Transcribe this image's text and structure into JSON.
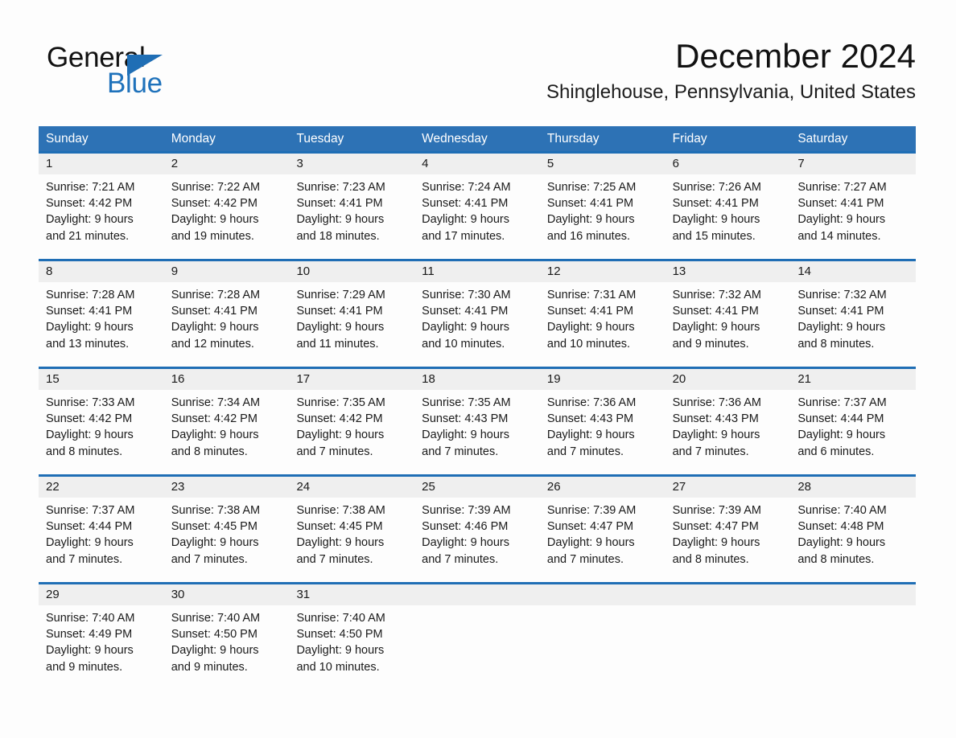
{
  "brand": {
    "name_part1": "General",
    "name_part2": "Blue",
    "triangle_color": "#1f6eb5",
    "blue_color": "#1f72bb"
  },
  "header": {
    "month_title": "December 2024",
    "location": "Shinglehouse, Pennsylvania, United States"
  },
  "theme": {
    "header_blue": "#2d72b5",
    "rule_blue": "#1f6eb5",
    "date_band_gray": "#efefef",
    "page_background": "#fdfdfd",
    "text_color": "#1a1a1a"
  },
  "weekdays": [
    "Sunday",
    "Monday",
    "Tuesday",
    "Wednesday",
    "Thursday",
    "Friday",
    "Saturday"
  ],
  "weeks": [
    {
      "days": [
        {
          "date": "1",
          "sunrise": "Sunrise: 7:21 AM",
          "sunset": "Sunset: 4:42 PM",
          "daylight_line1": "Daylight: 9 hours",
          "daylight_line2": "and 21 minutes."
        },
        {
          "date": "2",
          "sunrise": "Sunrise: 7:22 AM",
          "sunset": "Sunset: 4:42 PM",
          "daylight_line1": "Daylight: 9 hours",
          "daylight_line2": "and 19 minutes."
        },
        {
          "date": "3",
          "sunrise": "Sunrise: 7:23 AM",
          "sunset": "Sunset: 4:41 PM",
          "daylight_line1": "Daylight: 9 hours",
          "daylight_line2": "and 18 minutes."
        },
        {
          "date": "4",
          "sunrise": "Sunrise: 7:24 AM",
          "sunset": "Sunset: 4:41 PM",
          "daylight_line1": "Daylight: 9 hours",
          "daylight_line2": "and 17 minutes."
        },
        {
          "date": "5",
          "sunrise": "Sunrise: 7:25 AM",
          "sunset": "Sunset: 4:41 PM",
          "daylight_line1": "Daylight: 9 hours",
          "daylight_line2": "and 16 minutes."
        },
        {
          "date": "6",
          "sunrise": "Sunrise: 7:26 AM",
          "sunset": "Sunset: 4:41 PM",
          "daylight_line1": "Daylight: 9 hours",
          "daylight_line2": "and 15 minutes."
        },
        {
          "date": "7",
          "sunrise": "Sunrise: 7:27 AM",
          "sunset": "Sunset: 4:41 PM",
          "daylight_line1": "Daylight: 9 hours",
          "daylight_line2": "and 14 minutes."
        }
      ]
    },
    {
      "days": [
        {
          "date": "8",
          "sunrise": "Sunrise: 7:28 AM",
          "sunset": "Sunset: 4:41 PM",
          "daylight_line1": "Daylight: 9 hours",
          "daylight_line2": "and 13 minutes."
        },
        {
          "date": "9",
          "sunrise": "Sunrise: 7:28 AM",
          "sunset": "Sunset: 4:41 PM",
          "daylight_line1": "Daylight: 9 hours",
          "daylight_line2": "and 12 minutes."
        },
        {
          "date": "10",
          "sunrise": "Sunrise: 7:29 AM",
          "sunset": "Sunset: 4:41 PM",
          "daylight_line1": "Daylight: 9 hours",
          "daylight_line2": "and 11 minutes."
        },
        {
          "date": "11",
          "sunrise": "Sunrise: 7:30 AM",
          "sunset": "Sunset: 4:41 PM",
          "daylight_line1": "Daylight: 9 hours",
          "daylight_line2": "and 10 minutes."
        },
        {
          "date": "12",
          "sunrise": "Sunrise: 7:31 AM",
          "sunset": "Sunset: 4:41 PM",
          "daylight_line1": "Daylight: 9 hours",
          "daylight_line2": "and 10 minutes."
        },
        {
          "date": "13",
          "sunrise": "Sunrise: 7:32 AM",
          "sunset": "Sunset: 4:41 PM",
          "daylight_line1": "Daylight: 9 hours",
          "daylight_line2": "and 9 minutes."
        },
        {
          "date": "14",
          "sunrise": "Sunrise: 7:32 AM",
          "sunset": "Sunset: 4:41 PM",
          "daylight_line1": "Daylight: 9 hours",
          "daylight_line2": "and 8 minutes."
        }
      ]
    },
    {
      "days": [
        {
          "date": "15",
          "sunrise": "Sunrise: 7:33 AM",
          "sunset": "Sunset: 4:42 PM",
          "daylight_line1": "Daylight: 9 hours",
          "daylight_line2": "and 8 minutes."
        },
        {
          "date": "16",
          "sunrise": "Sunrise: 7:34 AM",
          "sunset": "Sunset: 4:42 PM",
          "daylight_line1": "Daylight: 9 hours",
          "daylight_line2": "and 8 minutes."
        },
        {
          "date": "17",
          "sunrise": "Sunrise: 7:35 AM",
          "sunset": "Sunset: 4:42 PM",
          "daylight_line1": "Daylight: 9 hours",
          "daylight_line2": "and 7 minutes."
        },
        {
          "date": "18",
          "sunrise": "Sunrise: 7:35 AM",
          "sunset": "Sunset: 4:43 PM",
          "daylight_line1": "Daylight: 9 hours",
          "daylight_line2": "and 7 minutes."
        },
        {
          "date": "19",
          "sunrise": "Sunrise: 7:36 AM",
          "sunset": "Sunset: 4:43 PM",
          "daylight_line1": "Daylight: 9 hours",
          "daylight_line2": "and 7 minutes."
        },
        {
          "date": "20",
          "sunrise": "Sunrise: 7:36 AM",
          "sunset": "Sunset: 4:43 PM",
          "daylight_line1": "Daylight: 9 hours",
          "daylight_line2": "and 7 minutes."
        },
        {
          "date": "21",
          "sunrise": "Sunrise: 7:37 AM",
          "sunset": "Sunset: 4:44 PM",
          "daylight_line1": "Daylight: 9 hours",
          "daylight_line2": "and 6 minutes."
        }
      ]
    },
    {
      "days": [
        {
          "date": "22",
          "sunrise": "Sunrise: 7:37 AM",
          "sunset": "Sunset: 4:44 PM",
          "daylight_line1": "Daylight: 9 hours",
          "daylight_line2": "and 7 minutes."
        },
        {
          "date": "23",
          "sunrise": "Sunrise: 7:38 AM",
          "sunset": "Sunset: 4:45 PM",
          "daylight_line1": "Daylight: 9 hours",
          "daylight_line2": "and 7 minutes."
        },
        {
          "date": "24",
          "sunrise": "Sunrise: 7:38 AM",
          "sunset": "Sunset: 4:45 PM",
          "daylight_line1": "Daylight: 9 hours",
          "daylight_line2": "and 7 minutes."
        },
        {
          "date": "25",
          "sunrise": "Sunrise: 7:39 AM",
          "sunset": "Sunset: 4:46 PM",
          "daylight_line1": "Daylight: 9 hours",
          "daylight_line2": "and 7 minutes."
        },
        {
          "date": "26",
          "sunrise": "Sunrise: 7:39 AM",
          "sunset": "Sunset: 4:47 PM",
          "daylight_line1": "Daylight: 9 hours",
          "daylight_line2": "and 7 minutes."
        },
        {
          "date": "27",
          "sunrise": "Sunrise: 7:39 AM",
          "sunset": "Sunset: 4:47 PM",
          "daylight_line1": "Daylight: 9 hours",
          "daylight_line2": "and 8 minutes."
        },
        {
          "date": "28",
          "sunrise": "Sunrise: 7:40 AM",
          "sunset": "Sunset: 4:48 PM",
          "daylight_line1": "Daylight: 9 hours",
          "daylight_line2": "and 8 minutes."
        }
      ]
    },
    {
      "days": [
        {
          "date": "29",
          "sunrise": "Sunrise: 7:40 AM",
          "sunset": "Sunset: 4:49 PM",
          "daylight_line1": "Daylight: 9 hours",
          "daylight_line2": "and 9 minutes."
        },
        {
          "date": "30",
          "sunrise": "Sunrise: 7:40 AM",
          "sunset": "Sunset: 4:50 PM",
          "daylight_line1": "Daylight: 9 hours",
          "daylight_line2": "and 9 minutes."
        },
        {
          "date": "31",
          "sunrise": "Sunrise: 7:40 AM",
          "sunset": "Sunset: 4:50 PM",
          "daylight_line1": "Daylight: 9 hours",
          "daylight_line2": "and 10 minutes."
        },
        {
          "date": "",
          "sunrise": "",
          "sunset": "",
          "daylight_line1": "",
          "daylight_line2": ""
        },
        {
          "date": "",
          "sunrise": "",
          "sunset": "",
          "daylight_line1": "",
          "daylight_line2": ""
        },
        {
          "date": "",
          "sunrise": "",
          "sunset": "",
          "daylight_line1": "",
          "daylight_line2": ""
        },
        {
          "date": "",
          "sunrise": "",
          "sunset": "",
          "daylight_line1": "",
          "daylight_line2": ""
        }
      ]
    }
  ]
}
